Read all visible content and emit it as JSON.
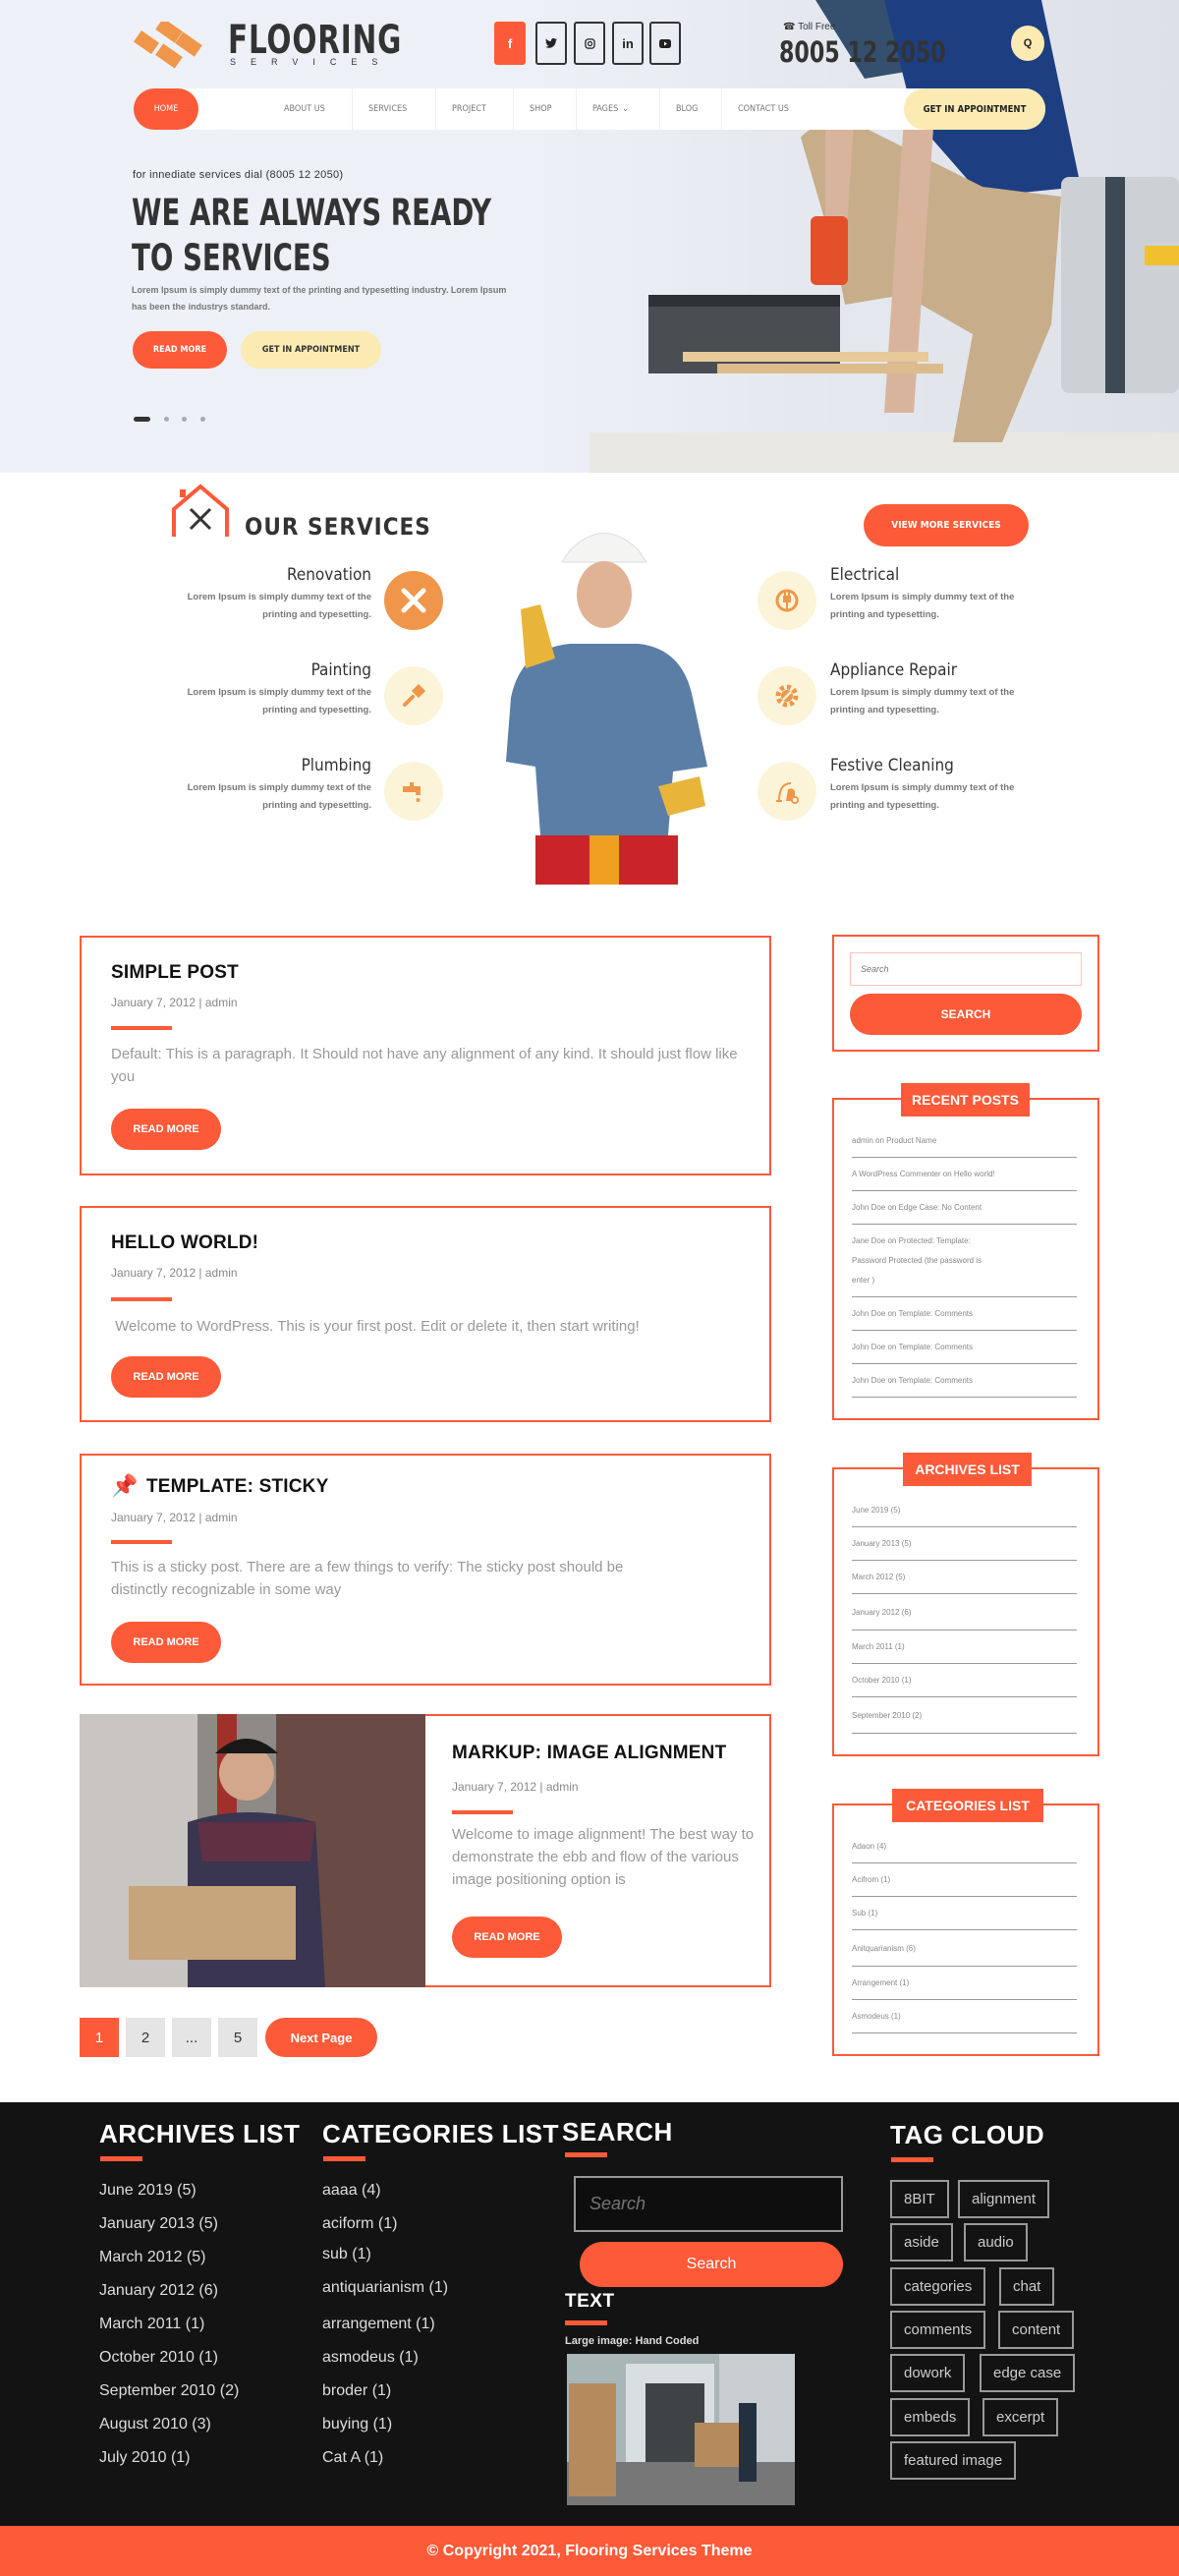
{
  "header": {
    "logo_title": "FLOORING",
    "logo_subtitle": "SERVICES",
    "social": [
      {
        "name": "facebook",
        "glyph": "f"
      },
      {
        "name": "twitter",
        "glyph": "🐦"
      },
      {
        "name": "instagram",
        "glyph": "◎"
      },
      {
        "name": "linkedin",
        "glyph": "in"
      },
      {
        "name": "youtube",
        "glyph": "▶"
      }
    ],
    "toll_label": "Toll Free",
    "toll_number": "8005 12 2050",
    "search_glyph": "Q",
    "nav": [
      {
        "label": "HOME"
      },
      {
        "label": "ABOUT US"
      },
      {
        "label": "SERVICES"
      },
      {
        "label": "PROJECT"
      },
      {
        "label": "SHOP"
      },
      {
        "label": "PAGES"
      },
      {
        "label": "BLOG"
      },
      {
        "label": "CONTACT US"
      }
    ],
    "appointment": "GET IN APPOINTMENT"
  },
  "hero": {
    "kicker": "for innediate services dial (8005 12 2050)",
    "title_line1": "WE ARE ALWAYS READY",
    "title_line2": "TO SERVICES",
    "description": "Lorem Ipsum is simply dummy text of the printing and typesetting industry. Lorem Ipsum has been the industrys standard.",
    "read_more": "READ MORE",
    "appointment": "GET IN APPOINTMENT",
    "slides": 4,
    "active_slide": 1
  },
  "services": {
    "title": "OUR SERVICES",
    "view_more": "VIEW MORE SERVICES",
    "left": [
      {
        "name": "Renovation",
        "desc": "Lorem Ipsum is simply dummy text of the printing and typesetting.",
        "icon": "tools-icon"
      },
      {
        "name": "Painting",
        "desc": "Lorem Ipsum is simply dummy text of the printing and typesetting.",
        "icon": "paintbrush-icon"
      },
      {
        "name": "Plumbing",
        "desc": "Lorem Ipsum is simply dummy text of the printing and typesetting.",
        "icon": "faucet-icon"
      }
    ],
    "right": [
      {
        "name": "Electrical",
        "desc": "Lorem Ipsum is simply dummy text of the printing and typesetting.",
        "icon": "plug-icon"
      },
      {
        "name": "Appliance Repair",
        "desc": "Lorem Ipsum is simply dummy text of the printing and typesetting.",
        "icon": "gear-wrench-icon"
      },
      {
        "name": "Festive Cleaning",
        "desc": "Lorem Ipsum is simply dummy text of the printing and typesetting.",
        "icon": "vacuum-icon"
      }
    ]
  },
  "posts": [
    {
      "title": "SIMPLE POST",
      "meta": "January 7, 2012 | admin",
      "body": "Default:  This is a paragraph. It Should not have any alignment of any kind. It should just flow like you",
      "button": "READ MORE"
    },
    {
      "title": "HELLO WORLD!",
      "meta": "January 7, 2012 | admin",
      "body": " Welcome to WordPress. This is your first post. Edit or delete it, then start writing!",
      "button": "READ MORE"
    },
    {
      "title": "TEMPLATE: STICKY",
      "meta": "January 7, 2012 | admin",
      "body": "This is a sticky post. There are a few things to verify: The sticky post should be distinctly recognizable in some way",
      "button": "READ MORE",
      "sticky": true
    },
    {
      "title": "MARKUP: IMAGE ALIGNMENT",
      "meta": "January 7, 2012 | admin",
      "body": "Welcome to image alignment! The best way to demonstrate the ebb and flow of the various image positioning option is",
      "button": "READ MORE"
    }
  ],
  "pagination": {
    "pages": [
      "1",
      "2",
      "...",
      "5"
    ],
    "current": "1",
    "next": "Next Page"
  },
  "sidebar": {
    "search_placeholder": "Search",
    "search_button": "SEARCH",
    "recent_title": "RECENT POSTS",
    "recent": [
      "admin on Product Name",
      "A WordPress Commenter on Hello world!",
      "John Doe on Edge Case: No Content",
      "Jane Doe on Protected: Template: Password Protected (the password is enter )",
      "John Doe on Template: Comments",
      "John Doe on Template: Comments",
      "John Doe on Template: Comments"
    ],
    "archives_title": "ARCHIVES LIST",
    "archives": [
      "June 2019 (5)",
      "January 2013 (5)",
      "March 2012 (5)",
      "January 2012 (6)",
      "March 2011 (1)",
      "October 2010 (1)",
      "September  2010 (2)"
    ],
    "categories_title": "CATEGORIES LIST",
    "categories": [
      "Adaon  (4)",
      "Acifrom (1)",
      "Sub (1)",
      "Anitquarianism (6)",
      "Arrangement (1)",
      "Asmodeus (1)"
    ]
  },
  "footer": {
    "archives_title": "ARCHIVES LIST",
    "archives": [
      "June 2019 (5)",
      "January 2013 (5)",
      "March 2012 (5)",
      "January 2012 (6)",
      "March 2011 (1)",
      "October 2010 (1)",
      "September 2010 (2)",
      "August 2010 (3)",
      "July 2010 (1)"
    ],
    "categories_title": "CATEGORIES LIST",
    "categories": [
      "aaaa (4)",
      "aciform (1)",
      "sub (1)",
      "antiquarianism (1)",
      "arrangement (1)",
      "asmodeus (1)",
      "broder (1)",
      "buying (1)",
      "Cat A (1)"
    ],
    "search_title": "SEARCH",
    "search_placeholder": "Search",
    "search_button": "Search",
    "text_title": "TEXT",
    "text_caption": "Large image: Hand Coded",
    "tag_title": "TAG CLOUD",
    "tags": [
      "8BIT",
      "alignment",
      "aside",
      "audio",
      "categories",
      "chat",
      "comments",
      "content",
      "dowork",
      "edge case",
      "embeds",
      "excerpt",
      "featured image"
    ],
    "copyright": "© Copyright 2021, Flooring Services Theme"
  },
  "colors": {
    "accent": "#fc5a38",
    "cream": "#fbebb3",
    "dark": "#131313"
  }
}
